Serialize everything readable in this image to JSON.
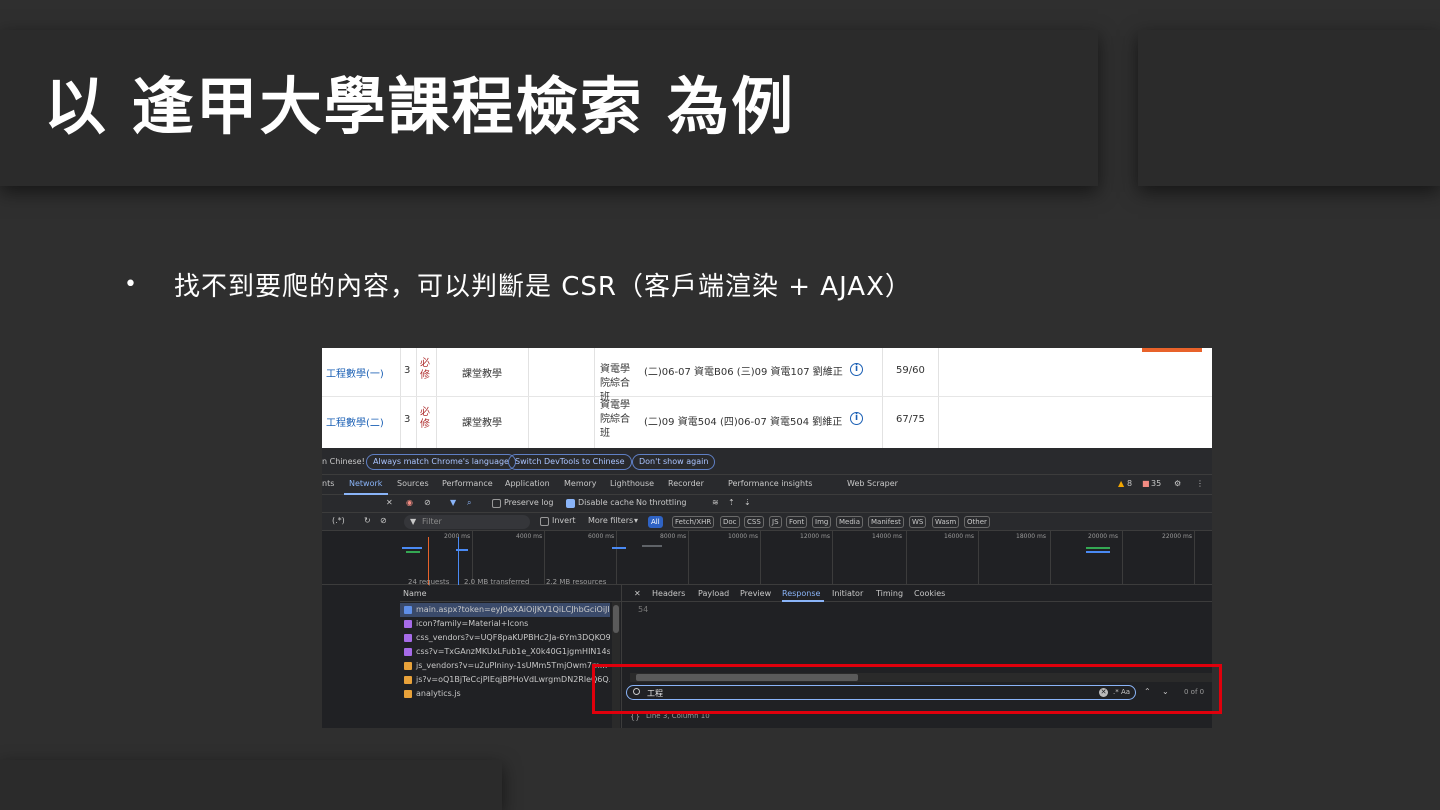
{
  "slide": {
    "title": "以 逢甲大學課程檢索 為例",
    "bullet": "•",
    "bullet_text": "找不到要爬的內容，可以判斷是 CSR（客戶端渲染 + AJAX）"
  },
  "course_table": {
    "rows": [
      {
        "name": "工程數學(一)",
        "credit": "3",
        "required": "必修",
        "mode": "課堂教學",
        "dept": "資電學院綜合班",
        "time": "(二)06-07 資電B06 (三)09 資電107 劉維正",
        "seats": "59/60"
      },
      {
        "name": "工程數學(二)",
        "credit": "3",
        "required": "必修",
        "mode": "課堂教學",
        "dept": "資電學院綜合班",
        "time": "(二)09 資電504 (四)06-07 資電504 劉維正",
        "seats": "67/75"
      }
    ]
  },
  "devtools": {
    "lang_bar": {
      "prefix": "n Chinese!",
      "always_match": "Always match Chrome's language",
      "switch": "Switch DevTools to Chinese",
      "dont_show": "Don't show again"
    },
    "tabs": [
      "nts",
      "Network",
      "Sources",
      "Performance",
      "Application",
      "Memory",
      "Lighthouse",
      "Recorder",
      "Performance insights",
      "Web Scraper"
    ],
    "warn_count": "8",
    "error_count": "35",
    "toolbar": {
      "preserve_log": "Preserve log",
      "disable_cache": "Disable cache",
      "throttling": "No throttling"
    },
    "filter": {
      "placeholder": "Filter",
      "invert": "Invert",
      "more_filters": "More filters",
      "types": [
        "All",
        "Fetch/XHR",
        "Doc",
        "CSS",
        "JS",
        "Font",
        "Img",
        "Media",
        "Manifest",
        "WS",
        "Wasm",
        "Other"
      ]
    },
    "timeline_ticks": [
      "2000 ms",
      "4000 ms",
      "6000 ms",
      "8000 ms",
      "10000 ms",
      "12000 ms",
      "14000 ms",
      "16000 ms",
      "18000 ms",
      "20000 ms",
      "22000 ms"
    ],
    "name_header": "Name",
    "requests": [
      "main.aspx?token=eyJ0eXAiOiJKV1QiLCJhbGciOiJI...",
      "icon?family=Material+Icons",
      "css_vendors?v=UQF8paKUPBHc2Ja-6Ym3DQKO9u...",
      "css?v=TxGAnzMKUxLFub1e_X0k40G1jgmHIN14s...",
      "js_vendors?v=u2uPIniny-1sUMm5TmjOwm7m...",
      "js?v=oQ1BjTeCcjPIEqjBPHoVdLwrgmDN2RleQ6Q...",
      "analytics.js"
    ],
    "detail_tabs": [
      "Headers",
      "Payload",
      "Preview",
      "Response",
      "Initiator",
      "Timing",
      "Cookies"
    ],
    "response_line": "54",
    "search_value": "工程",
    "search_opts": ".*  Aa",
    "match_count": "0 of 0",
    "status_requests": "24 requests",
    "status_transferred": "2.0 MB transferred",
    "status_resources": "2.2 MB resources",
    "status_cursor": "Line 3, Column 10"
  }
}
